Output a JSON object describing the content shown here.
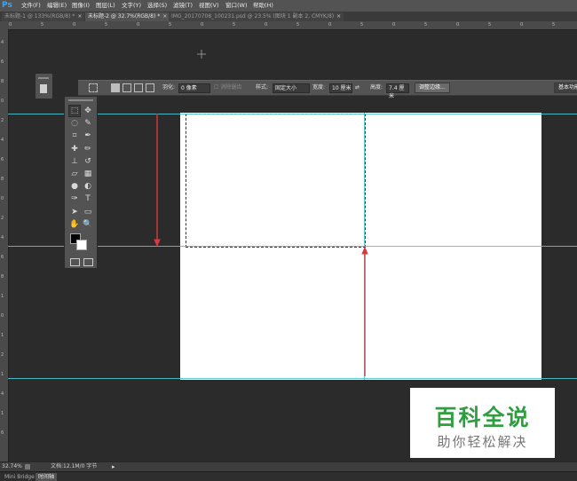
{
  "app": {
    "logo": "Ps"
  },
  "menubar": {
    "items": [
      "文件(F)",
      "编辑(E)",
      "图像(I)",
      "图层(L)",
      "文字(Y)",
      "选择(S)",
      "滤镜(T)",
      "视图(V)",
      "窗口(W)",
      "帮助(H)"
    ]
  },
  "tabs": [
    {
      "label": "未标题-1 @ 133%(RGB/8) *",
      "close": "×"
    },
    {
      "label": "未标题-2 @ 32.7%(RGB/8) *",
      "close": "×"
    },
    {
      "label": "IMG_20170708_100231.psd @ 23.5% (图块 1 副本 2, CMYK/8)",
      "close": "×"
    }
  ],
  "top_ruler_ticks": [
    "0",
    "5",
    "0",
    "5",
    "0",
    "5",
    "0",
    "5",
    "0",
    "5",
    "0",
    "5",
    "0",
    "5",
    "0",
    "5",
    "0",
    "5"
  ],
  "left_ruler_ticks": [
    "4",
    "6",
    "8",
    "0",
    "2",
    "4",
    "6",
    "8",
    "0",
    "2",
    "4",
    "6",
    "8",
    "1",
    "0",
    "1",
    "2",
    "1",
    "4",
    "1",
    "6"
  ],
  "options_bar": {
    "feather_label": "羽化:",
    "feather_value": "0 像素",
    "antialias_label": "消除锯齿",
    "style_label": "样式:",
    "style_value": "固定大小",
    "width_label": "宽度:",
    "width_value": "10 厘米",
    "height_label": "高度:",
    "height_value": "7.4 厘米",
    "refine_button": "调整边缘...",
    "workspace_button": "基本功能"
  },
  "toolbox": {
    "tools": [
      [
        "marquee-tool-icon",
        "⬚"
      ],
      [
        "move-tool-icon",
        "✥"
      ],
      [
        "lasso-tool-icon",
        "◌"
      ],
      [
        "quick-select-icon",
        "✎"
      ],
      [
        "crop-tool-icon",
        "⌗"
      ],
      [
        "eyedropper-icon",
        "✒"
      ],
      [
        "healing-brush-icon",
        "✚"
      ],
      [
        "brush-tool-icon",
        "✏"
      ],
      [
        "clone-stamp-icon",
        "⊥"
      ],
      [
        "history-brush-icon",
        "↺"
      ],
      [
        "eraser-icon",
        "▱"
      ],
      [
        "gradient-tool-icon",
        "▦"
      ],
      [
        "blur-tool-icon",
        "●"
      ],
      [
        "dodge-tool-icon",
        "◐"
      ],
      [
        "pen-tool-icon",
        "✑"
      ],
      [
        "type-tool-icon",
        "T"
      ],
      [
        "path-select-icon",
        "➤"
      ],
      [
        "shape-tool-icon",
        "▭"
      ],
      [
        "hand-tool-icon",
        "✋"
      ],
      [
        "zoom-tool-icon",
        "🔍"
      ]
    ],
    "foreground_color": "#000000",
    "background_color": "#ffffff"
  },
  "guide_color": "#4ac6d6",
  "arrow_color": "#d8393a",
  "watermark": {
    "title": "百科全说",
    "subtitle": "助你轻松解决",
    "title_color": "#2e9e3f"
  },
  "statusbar": {
    "zoom": "32.74%",
    "doc_info": "文档:12.1M/0 字节"
  },
  "bottom_tabs": [
    "Mini Bridge",
    "时间轴"
  ]
}
